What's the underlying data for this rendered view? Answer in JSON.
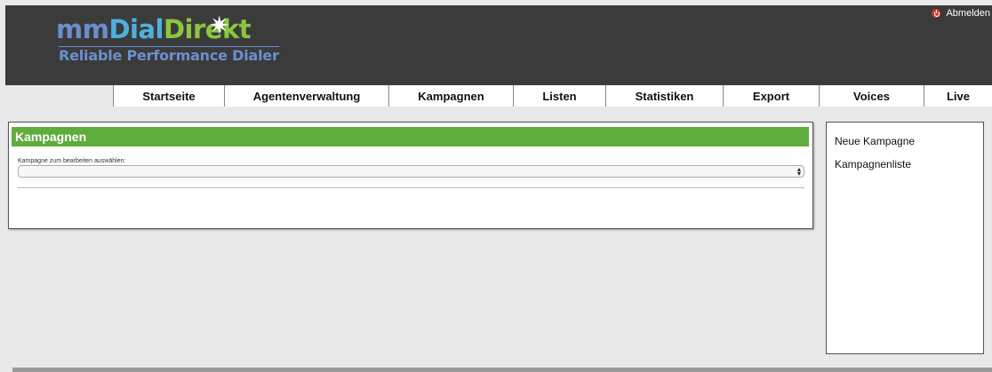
{
  "header": {
    "logo": {
      "title_mm": "mm",
      "title_dial": "Dial",
      "title_direkt": "Direkt",
      "subtitle": "Reliable Performance Dialer",
      "star_icon": "sparkle-icon"
    },
    "logout": {
      "label": "Abmelden",
      "icon": "power-icon"
    }
  },
  "nav": {
    "items": [
      {
        "label": "Startseite"
      },
      {
        "label": "Agentenverwaltung"
      },
      {
        "label": "Kampagnen"
      },
      {
        "label": "Listen"
      },
      {
        "label": "Statistiken"
      },
      {
        "label": "Export"
      },
      {
        "label": "Voices"
      },
      {
        "label": "Live"
      }
    ]
  },
  "main": {
    "title": "Kampagnen",
    "select_label": "Kampagne zum bearbeiten auswählen:",
    "select_value": ""
  },
  "sidebar": {
    "links": [
      {
        "label": "Neue Kampagne"
      },
      {
        "label": "Kampagnenliste"
      }
    ]
  },
  "colors": {
    "header_bg": "#3b3b3b",
    "accent_green": "#5fad3c",
    "logout_red": "#d9302c"
  }
}
